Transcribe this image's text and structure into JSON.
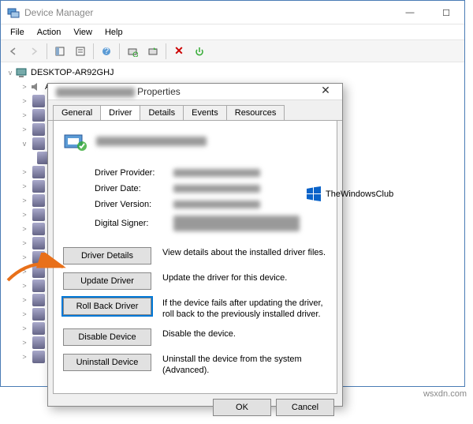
{
  "window": {
    "title": "Device Manager",
    "menus": [
      "File",
      "Action",
      "View",
      "Help"
    ],
    "win_controls": {
      "minimize": "—",
      "maximize": "☐"
    }
  },
  "tree": {
    "root": "DESKTOP-AR92GHJ",
    "first_child": "Audio inputs and outputs"
  },
  "props": {
    "title_suffix": "Properties",
    "tabs": [
      "General",
      "Driver",
      "Details",
      "Events",
      "Resources"
    ],
    "active_tab": 1,
    "info": [
      {
        "label": "Driver Provider:"
      },
      {
        "label": "Driver Date:"
      },
      {
        "label": "Driver Version:"
      },
      {
        "label": "Digital Signer:"
      }
    ],
    "buttons": [
      {
        "label": "Driver Details",
        "desc": "View details about the installed driver files."
      },
      {
        "label": "Update Driver",
        "desc": "Update the driver for this device."
      },
      {
        "label": "Roll Back Driver",
        "desc": "If the device fails after updating the driver, roll back to the previously installed driver."
      },
      {
        "label": "Disable Device",
        "desc": "Disable the device."
      },
      {
        "label": "Uninstall Device",
        "desc": "Uninstall the device from the system (Advanced)."
      }
    ],
    "footer": {
      "ok": "OK",
      "cancel": "Cancel"
    }
  },
  "anno": {
    "twc": "TheWindowsClub",
    "wsxdn": "wsxdn.com"
  }
}
